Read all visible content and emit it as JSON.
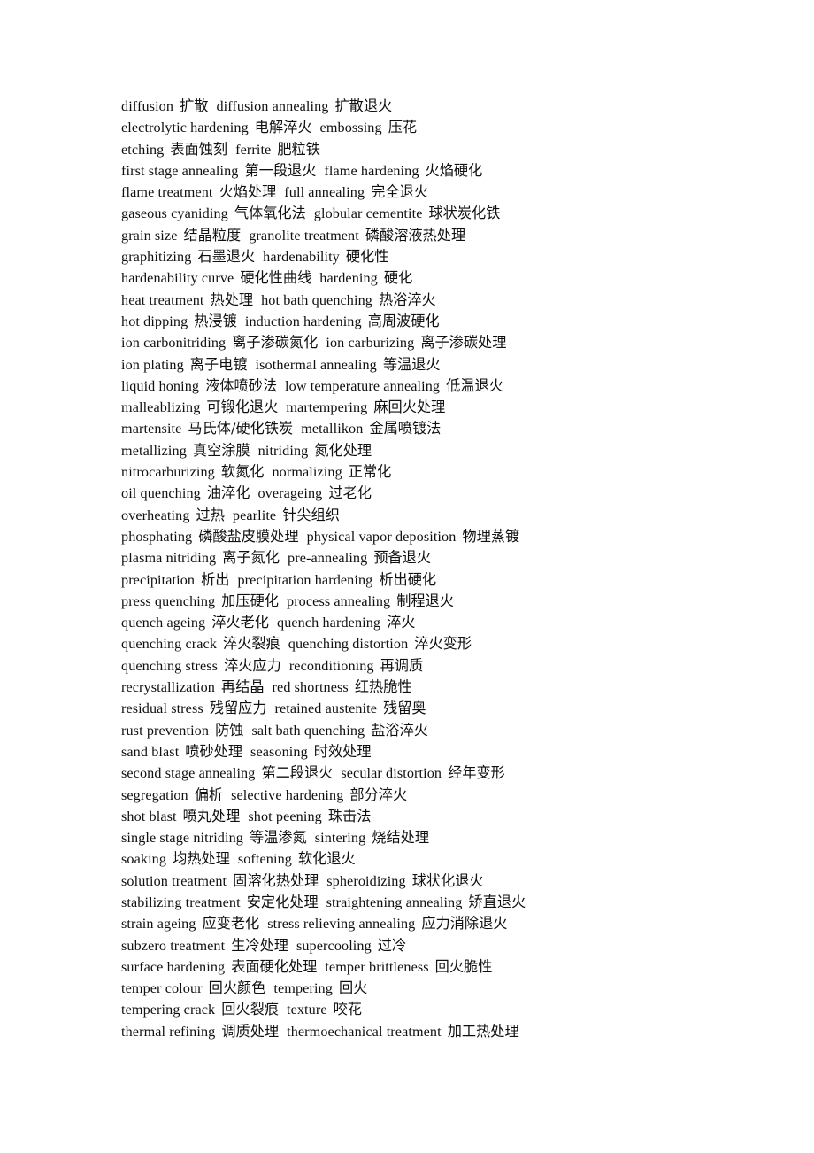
{
  "document": {
    "type": "bilingual-glossary",
    "subject": "heat treatment and surface engineering terminology",
    "language_pair": "English-Chinese",
    "line_count": 44,
    "lines": [
      [
        {
          "term": "diffusion",
          "gloss": "扩散"
        },
        {
          "term": "diffusion annealing",
          "gloss": "扩散退火"
        }
      ],
      [
        {
          "term": "electrolytic hardening",
          "gloss": "电解淬火"
        },
        {
          "term": "embossing",
          "gloss": "压花"
        }
      ],
      [
        {
          "term": "etching",
          "gloss": "表面蚀刻"
        },
        {
          "term": "ferrite",
          "gloss": "肥粒铁"
        }
      ],
      [
        {
          "term": "first stage annealing",
          "gloss": "第一段退火"
        },
        {
          "term": "flame hardening",
          "gloss": "火焰硬化"
        }
      ],
      [
        {
          "term": "flame treatment",
          "gloss": "火焰处理"
        },
        {
          "term": "full annealing",
          "gloss": "完全退火"
        }
      ],
      [
        {
          "term": "gaseous cyaniding",
          "gloss": "气体氧化法"
        },
        {
          "term": "globular cementite",
          "gloss": "球状炭化铁"
        }
      ],
      [
        {
          "term": "grain size",
          "gloss": "结晶粒度"
        },
        {
          "term": "granolite treatment",
          "gloss": "磷酸溶液热处理"
        }
      ],
      [
        {
          "term": "graphitizing",
          "gloss": "石墨退火"
        },
        {
          "term": "hardenability",
          "gloss": "硬化性"
        }
      ],
      [
        {
          "term": "hardenability curve",
          "gloss": "硬化性曲线"
        },
        {
          "term": "hardening",
          "gloss": "硬化"
        }
      ],
      [
        {
          "term": "heat treatment",
          "gloss": "热处理"
        },
        {
          "term": "hot bath quenching",
          "gloss": "热浴淬火"
        }
      ],
      [
        {
          "term": "hot dipping",
          "gloss": "热浸镀"
        },
        {
          "term": "induction hardening",
          "gloss": "高周波硬化"
        }
      ],
      [
        {
          "term": "ion carbonitriding",
          "gloss": "离子渗碳氮化"
        },
        {
          "term": "ion carburizing",
          "gloss": "离子渗碳处理"
        }
      ],
      [
        {
          "term": "ion plating",
          "gloss": "离子电镀"
        },
        {
          "term": "isothermal annealing",
          "gloss": "等温退火"
        }
      ],
      [
        {
          "term": "liquid honing",
          "gloss": "液体喷砂法"
        },
        {
          "term": "low temperature annealing",
          "gloss": "低温退火"
        }
      ],
      [
        {
          "term": "malleablizing",
          "gloss": "可锻化退火"
        },
        {
          "term": "martempering",
          "gloss": "麻回火处理"
        }
      ],
      [
        {
          "term": "martensite",
          "gloss": "马氏体/硬化铁炭"
        },
        {
          "term": "metallikon",
          "gloss": "金属喷镀法"
        }
      ],
      [
        {
          "term": "metallizing",
          "gloss": "真空涂膜"
        },
        {
          "term": "nitriding",
          "gloss": "氮化处理"
        }
      ],
      [
        {
          "term": "nitrocarburizing",
          "gloss": "软氮化"
        },
        {
          "term": "normalizing",
          "gloss": "正常化"
        }
      ],
      [
        {
          "term": "oil quenching",
          "gloss": "油淬化"
        },
        {
          "term": "overageing",
          "gloss": "过老化"
        }
      ],
      [
        {
          "term": "overheating",
          "gloss": "过热"
        },
        {
          "term": "pearlite",
          "gloss": "针尖组织"
        }
      ],
      [
        {
          "term": "phosphating",
          "gloss": "磷酸盐皮膜处理"
        },
        {
          "term": "physical vapor deposition",
          "gloss": "物理蒸镀"
        }
      ],
      [
        {
          "term": "plasma nitriding",
          "gloss": "离子氮化"
        },
        {
          "term": "pre-annealing",
          "gloss": "预备退火"
        }
      ],
      [
        {
          "term": "precipitation",
          "gloss": "析出"
        },
        {
          "term": "precipitation hardening",
          "gloss": "析出硬化"
        }
      ],
      [
        {
          "term": "press quenching",
          "gloss": "加压硬化"
        },
        {
          "term": "process annealing",
          "gloss": "制程退火"
        }
      ],
      [
        {
          "term": "quench ageing",
          "gloss": "淬火老化"
        },
        {
          "term": "quench hardening",
          "gloss": "淬火"
        }
      ],
      [
        {
          "term": "quenching crack",
          "gloss": "淬火裂痕"
        },
        {
          "term": "quenching distortion",
          "gloss": "淬火变形"
        }
      ],
      [
        {
          "term": "quenching stress",
          "gloss": "淬火应力"
        },
        {
          "term": "reconditioning",
          "gloss": "再调质"
        }
      ],
      [
        {
          "term": "recrystallization",
          "gloss": "再结晶"
        },
        {
          "term": "red shortness",
          "gloss": "红热脆性"
        }
      ],
      [
        {
          "term": "residual stress",
          "gloss": "残留应力"
        },
        {
          "term": "retained austenite",
          "gloss": "残留奥"
        }
      ],
      [
        {
          "term": "rust prevention",
          "gloss": "防蚀"
        },
        {
          "term": "salt bath quenching",
          "gloss": "盐浴淬火"
        }
      ],
      [
        {
          "term": "sand blast",
          "gloss": "喷砂处理"
        },
        {
          "term": "seasoning",
          "gloss": "时效处理"
        }
      ],
      [
        {
          "term": "second stage annealing",
          "gloss": "第二段退火"
        },
        {
          "term": "secular distortion",
          "gloss": "经年变形"
        }
      ],
      [
        {
          "term": "segregation",
          "gloss": "偏析"
        },
        {
          "term": "selective hardening",
          "gloss": "部分淬火"
        }
      ],
      [
        {
          "term": "shot blast",
          "gloss": "喷丸处理"
        },
        {
          "term": "shot peening",
          "gloss": "珠击法"
        }
      ],
      [
        {
          "term": "single stage nitriding",
          "gloss": "等温渗氮"
        },
        {
          "term": "sintering",
          "gloss": "烧结处理"
        }
      ],
      [
        {
          "term": "soaking",
          "gloss": "均热处理"
        },
        {
          "term": "softening",
          "gloss": "软化退火"
        }
      ],
      [
        {
          "term": "solution treatment",
          "gloss": "固溶化热处理"
        },
        {
          "term": "spheroidizing",
          "gloss": "球状化退火"
        }
      ],
      [
        {
          "term": "stabilizing treatment",
          "gloss": "安定化处理"
        },
        {
          "term": "straightening annealing",
          "gloss": "矫直退火"
        }
      ],
      [
        {
          "term": "strain ageing",
          "gloss": "应变老化"
        },
        {
          "term": "stress relieving annealing",
          "gloss": "应力消除退火"
        }
      ],
      [
        {
          "term": "subzero treatment",
          "gloss": "生冷处理"
        },
        {
          "term": "supercooling",
          "gloss": "过冷"
        }
      ],
      [
        {
          "term": "surface hardening",
          "gloss": "表面硬化处理"
        },
        {
          "term": "temper brittleness",
          "gloss": "回火脆性"
        }
      ],
      [
        {
          "term": "temper colour",
          "gloss": "回火颜色"
        },
        {
          "term": "tempering",
          "gloss": "回火"
        }
      ],
      [
        {
          "term": "tempering crack",
          "gloss": "回火裂痕"
        },
        {
          "term": "texture",
          "gloss": "咬花"
        }
      ],
      [
        {
          "term": "thermal refining",
          "gloss": "调质处理"
        },
        {
          "term": "thermoechanical treatment",
          "gloss": "加工热处理"
        }
      ]
    ]
  }
}
